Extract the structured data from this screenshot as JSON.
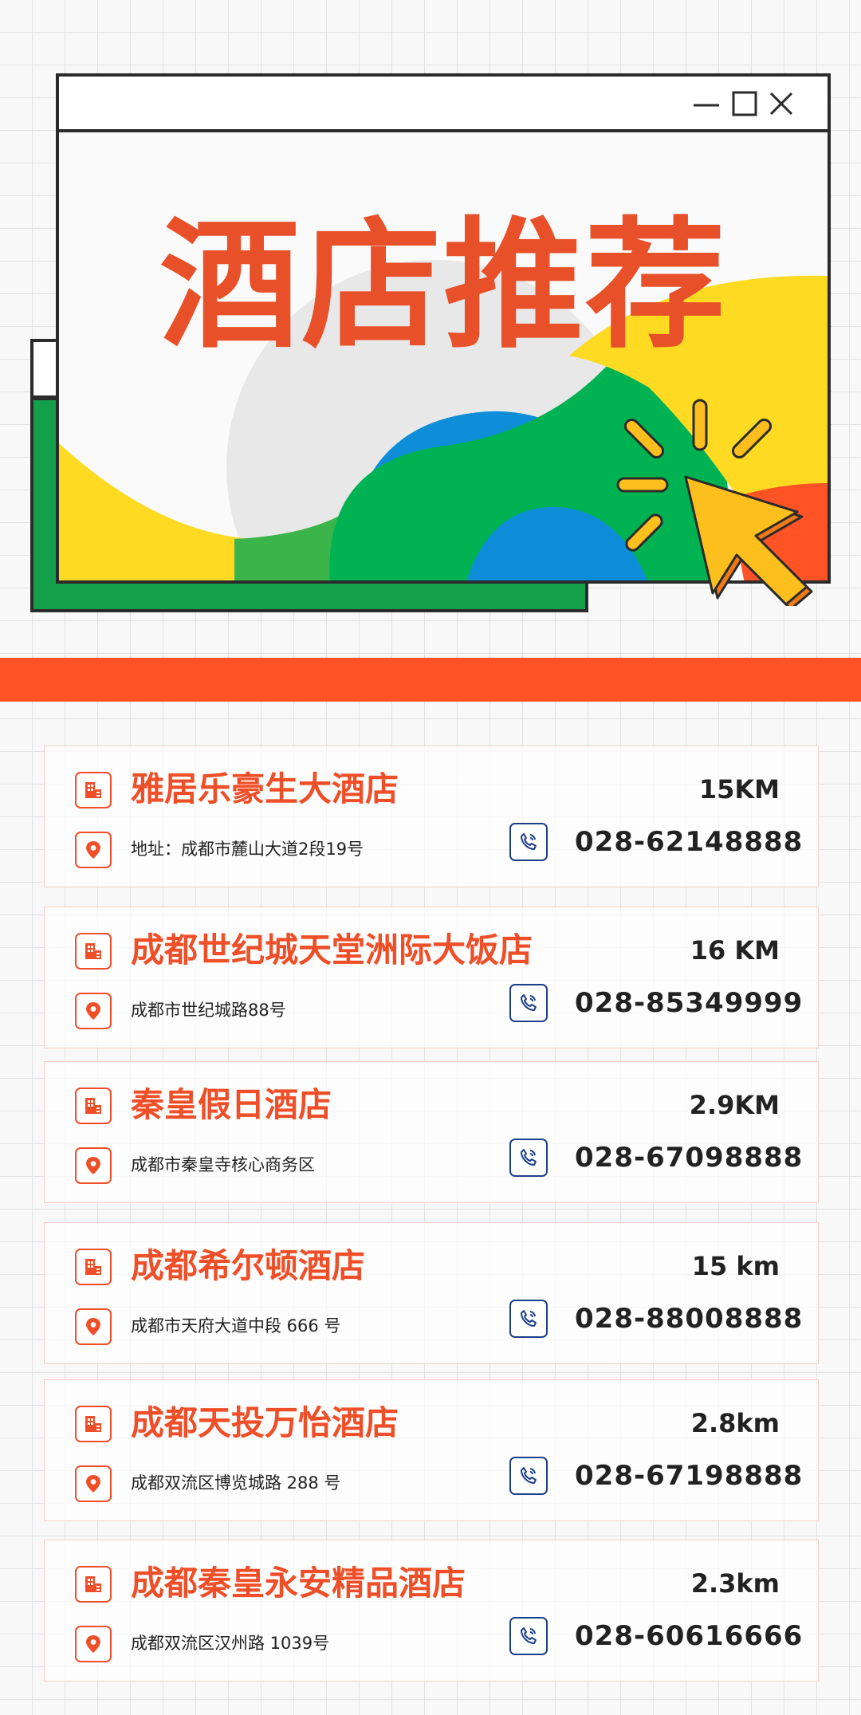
{
  "hero": {
    "title": "酒店推荐",
    "window_controls": [
      "minimize-icon",
      "maximize-icon",
      "close-icon"
    ]
  },
  "colors": {
    "accent_orange": "#ff5326",
    "title_orange": "#e8502a",
    "green": "#14a04a",
    "blue": "#0e8ed8",
    "yellow": "#fedb22",
    "phone_blue": "#1d3f8a"
  },
  "hotels": [
    {
      "name": "雅居乐豪生大酒店",
      "address": "地址：成都市麓山大道2段19号",
      "distance": "15KM",
      "phone": "028-62148888"
    },
    {
      "name": "成都世纪城天堂洲际大饭店",
      "address": "成都市世纪城路88号",
      "distance": "16 KM",
      "phone": "028-85349999"
    },
    {
      "name": "秦皇假日酒店",
      "address": "成都市秦皇寺核心商务区",
      "distance": "2.9KM",
      "phone": "028-67098888"
    },
    {
      "name": "成都希尔顿酒店",
      "address": "成都市天府大道中段 666 号",
      "distance": "15 km",
      "phone": "028-88008888"
    },
    {
      "name": "成都天投万怡酒店",
      "address": "成都双流区博览城路 288 号",
      "distance": "2.8km",
      "phone": "028-67198888"
    },
    {
      "name": "成都秦皇永安精品酒店",
      "address": "成都双流区汉州路 1039号",
      "distance": "2.3km",
      "phone": "028-60616666"
    }
  ]
}
